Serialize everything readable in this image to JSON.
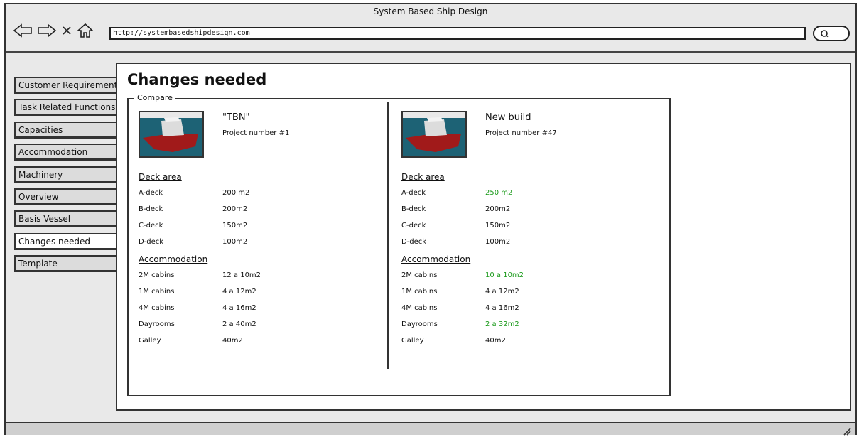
{
  "window": {
    "title": "System Based Ship Design"
  },
  "browser": {
    "url": "http://systembasedshipdesign.com"
  },
  "sidebar": {
    "items": [
      {
        "label": "Customer Requirements"
      },
      {
        "label": "Task Related Functions"
      },
      {
        "label": "Capacities"
      },
      {
        "label": "Accommodation"
      },
      {
        "label": "Machinery"
      },
      {
        "label": "Overview"
      },
      {
        "label": "Basis Vessel"
      },
      {
        "label": "Changes needed"
      },
      {
        "label": "Template"
      }
    ],
    "active": "Changes needed"
  },
  "page": {
    "title": "Changes needed",
    "group_label": "Compare"
  },
  "colors": {
    "changed": "#1a9a1a"
  },
  "left": {
    "name": "\"TBN\"",
    "project": "Project number #1",
    "deck_heading": "Deck area",
    "deck": [
      {
        "label": "A-deck",
        "value": "200 m2"
      },
      {
        "label": "B-deck",
        "value": "200m2"
      },
      {
        "label": "C-deck",
        "value": "150m2"
      },
      {
        "label": "D-deck",
        "value": "100m2"
      }
    ],
    "accom_heading": "Accommodation",
    "accom": [
      {
        "label": "2M cabins",
        "value": "12  a  10m2"
      },
      {
        "label": "1M cabins",
        "value": "4  a  12m2"
      },
      {
        "label": "4M cabins",
        "value": "4  a  16m2"
      },
      {
        "label": "Dayrooms",
        "value": "2  a  40m2"
      },
      {
        "label": "Galley",
        "value": "40m2"
      }
    ]
  },
  "right": {
    "name": "New build",
    "project": "Project number #47",
    "deck_heading": "Deck area",
    "deck": [
      {
        "label": "A-deck",
        "value": "250 m2",
        "changed": true
      },
      {
        "label": "B-deck",
        "value": "200m2"
      },
      {
        "label": "C-deck",
        "value": "150m2"
      },
      {
        "label": "D-deck",
        "value": "100m2"
      }
    ],
    "accom_heading": "Accommodation",
    "accom": [
      {
        "label": "2M cabins",
        "value": "10  a  10m2",
        "changed": true
      },
      {
        "label": "1M cabins",
        "value": "4  a  12m2"
      },
      {
        "label": "4M cabins",
        "value": "4  a  16m2"
      },
      {
        "label": "Dayrooms",
        "value": "2  a  32m2",
        "changed": true
      },
      {
        "label": "Galley",
        "value": "40m2"
      }
    ]
  }
}
